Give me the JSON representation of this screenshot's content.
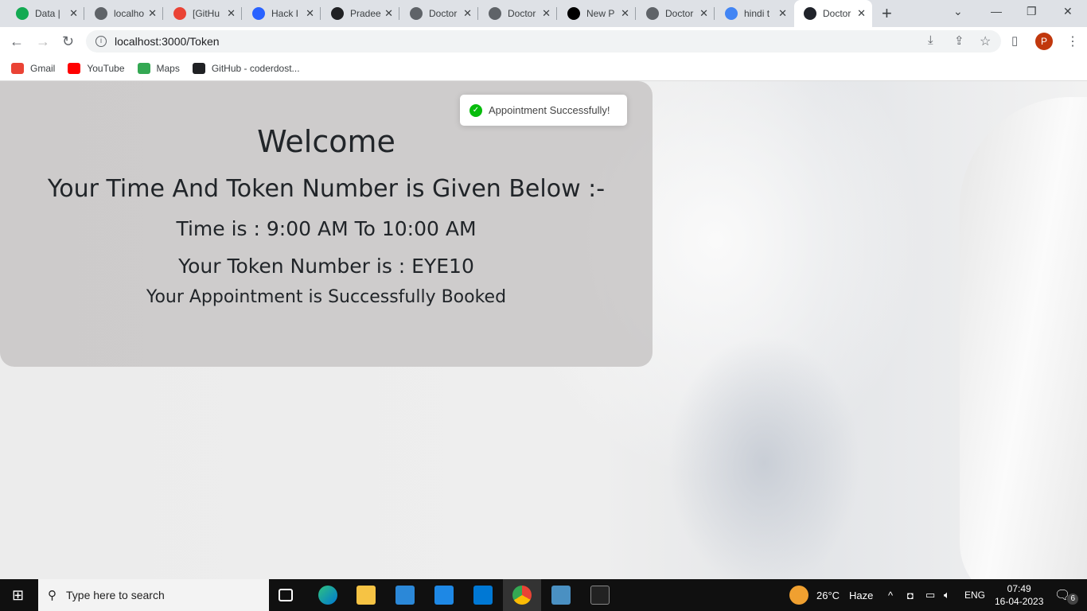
{
  "browser": {
    "tabs": [
      {
        "title": "Data |",
        "icon": "mongodb-icon",
        "color": "#13aa52"
      },
      {
        "title": "localho",
        "icon": "globe-icon",
        "color": "#5f6368"
      },
      {
        "title": "[GitHu",
        "icon": "gmail-icon",
        "color": "#ea4335"
      },
      {
        "title": "Hack I",
        "icon": "hashnode-icon",
        "color": "#2962ff"
      },
      {
        "title": "Pradee",
        "icon": "github-icon",
        "color": "#202124"
      },
      {
        "title": "Doctor",
        "icon": "globe-icon",
        "color": "#5f6368"
      },
      {
        "title": "Doctor",
        "icon": "globe-icon",
        "color": "#5f6368"
      },
      {
        "title": "New P",
        "icon": "vercel-icon",
        "color": "#000000"
      },
      {
        "title": "Doctor",
        "icon": "globe-icon",
        "color": "#5f6368"
      },
      {
        "title": "hindi t",
        "icon": "google-icon",
        "color": "#4285f4"
      },
      {
        "title": "Doctor",
        "icon": "react-icon",
        "color": "#20232a",
        "active": true
      }
    ],
    "url": "localhost:3000/Token",
    "profile_initial": "P",
    "bookmarks": [
      {
        "label": "Gmail",
        "color": "#ea4335"
      },
      {
        "label": "YouTube",
        "color": "#ff0000"
      },
      {
        "label": "Maps",
        "color": "#34a853"
      },
      {
        "label": "GitHub - coderdost...",
        "color": "#202124"
      }
    ]
  },
  "card": {
    "welcome": "Welcome",
    "subtitle": "Your Time And Token Number is Given Below :-",
    "time": "Time is : 9:00 AM To 10:00 AM",
    "token": "Your Token Number is : EYE10",
    "status": "Your Appointment is Successfully Booked"
  },
  "toast": {
    "message": "Appointment Successfully!",
    "color": "#07bc0c"
  },
  "taskbar": {
    "search_placeholder": "Type here to search",
    "weather_temp": "26°C",
    "weather_desc": "Haze",
    "language": "ENG",
    "time": "07:49",
    "date": "16-04-2023",
    "notifications": "6"
  }
}
